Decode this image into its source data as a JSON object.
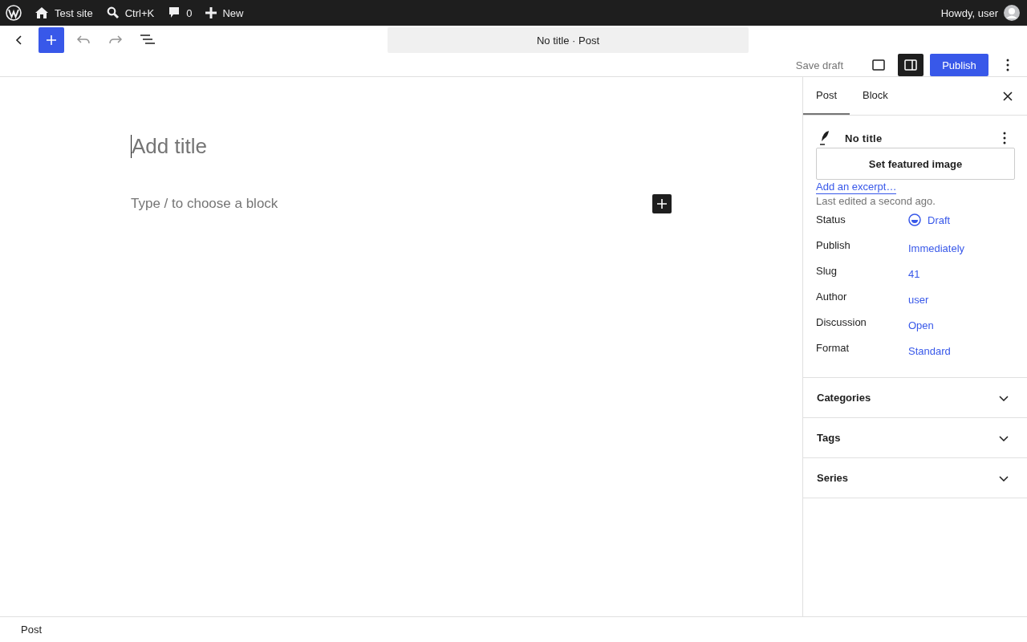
{
  "admin_bar": {
    "site": "Test site",
    "search_shortcut": "Ctrl+K",
    "comments": "0",
    "new": "New",
    "greeting": "Howdy, user"
  },
  "toolbar": {
    "document_title": "No title · Post",
    "save_draft": "Save draft",
    "publish": "Publish",
    "settings_selected": true
  },
  "editor": {
    "title_placeholder": "Add title",
    "block_placeholder": "Type / to choose a block"
  },
  "sidebar": {
    "tabs": [
      {
        "label": "Post",
        "selected": true
      },
      {
        "label": "Block",
        "selected": false
      }
    ],
    "post_title": "No title",
    "featured_image": "Set featured image",
    "excerpt_link": "Add an excerpt…",
    "last_edited": "Last edited a second ago.",
    "fields": [
      {
        "label": "Status",
        "value": "Draft",
        "kind": "status"
      },
      {
        "label": "Publish",
        "value": "Immediately",
        "kind": "link"
      },
      {
        "label": "Slug",
        "value": "41",
        "kind": "link"
      },
      {
        "label": "Author",
        "value": "user",
        "kind": "link"
      },
      {
        "label": "Discussion",
        "value": "Open",
        "kind": "link"
      },
      {
        "label": "Format",
        "value": "Standard",
        "kind": "link"
      }
    ],
    "panels": [
      {
        "title": "Categories",
        "expanded": false
      },
      {
        "title": "Tags",
        "expanded": false
      },
      {
        "title": "Series",
        "expanded": false
      }
    ]
  },
  "footer": {
    "breadcrumb": "Post"
  }
}
